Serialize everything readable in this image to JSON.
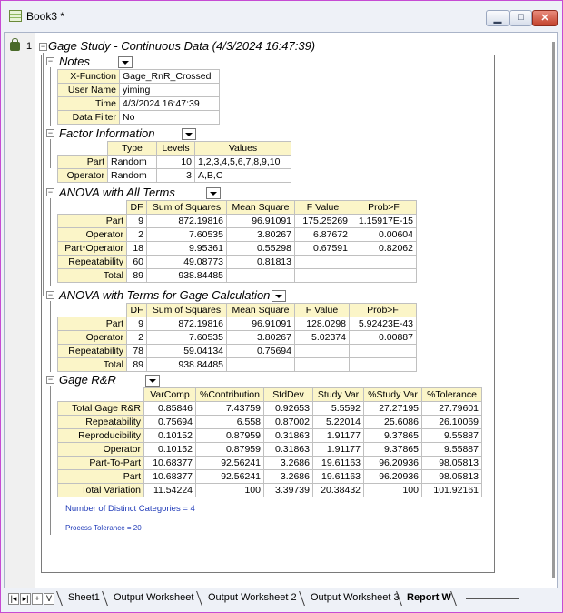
{
  "window": {
    "title": "Book3 *",
    "min_glyph": "▁",
    "max_glyph": "□",
    "close_glyph": "✕"
  },
  "row_number": "1",
  "report": {
    "title": "Gage Study - Continuous Data (4/3/2024 16:47:39)"
  },
  "notes": {
    "title": "Notes",
    "rows": [
      {
        "label": "X-Function",
        "value": "Gage_RnR_Crossed"
      },
      {
        "label": "User Name",
        "value": "yiming"
      },
      {
        "label": "Time",
        "value": "4/3/2024 16:47:39"
      },
      {
        "label": "Data Filter",
        "value": "No"
      }
    ]
  },
  "factor_info": {
    "title": "Factor Information",
    "headers": [
      "Type",
      "Levels",
      "Values"
    ],
    "rows": [
      {
        "label": "Part",
        "type": "Random",
        "levels": "10",
        "values": "1,2,3,4,5,6,7,8,9,10"
      },
      {
        "label": "Operator",
        "type": "Random",
        "levels": "3",
        "values": "A,B,C"
      }
    ]
  },
  "anova_all": {
    "title": "ANOVA with All Terms",
    "headers": [
      "DF",
      "Sum of Squares",
      "Mean Square",
      "F Value",
      "Prob>F"
    ],
    "rows": [
      {
        "label": "Part",
        "df": "9",
        "ss": "872.19816",
        "ms": "96.91091",
        "f": "175.25269",
        "p": "1.15917E-15"
      },
      {
        "label": "Operator",
        "df": "2",
        "ss": "7.60535",
        "ms": "3.80267",
        "f": "6.87672",
        "p": "0.00604"
      },
      {
        "label": "Part*Operator",
        "df": "18",
        "ss": "9.95361",
        "ms": "0.55298",
        "f": "0.67591",
        "p": "0.82062"
      },
      {
        "label": "Repeatability",
        "df": "60",
        "ss": "49.08773",
        "ms": "0.81813",
        "f": "",
        "p": ""
      },
      {
        "label": "Total",
        "df": "89",
        "ss": "938.84485",
        "ms": "",
        "f": "",
        "p": ""
      }
    ]
  },
  "anova_gage": {
    "title": "ANOVA with Terms for Gage Calculation",
    "headers": [
      "DF",
      "Sum of Squares",
      "Mean Square",
      "F Value",
      "Prob>F"
    ],
    "rows": [
      {
        "label": "Part",
        "df": "9",
        "ss": "872.19816",
        "ms": "96.91091",
        "f": "128.0298",
        "p": "5.92423E-43"
      },
      {
        "label": "Operator",
        "df": "2",
        "ss": "7.60535",
        "ms": "3.80267",
        "f": "5.02374",
        "p": "0.00887"
      },
      {
        "label": "Repeatability",
        "df": "78",
        "ss": "59.04134",
        "ms": "0.75694",
        "f": "",
        "p": ""
      },
      {
        "label": "Total",
        "df": "89",
        "ss": "938.84485",
        "ms": "",
        "f": "",
        "p": ""
      }
    ]
  },
  "gage_rr": {
    "title": "Gage R&R",
    "headers": [
      "VarComp",
      "%Contribution",
      "StdDev",
      "Study Var",
      "%Study Var",
      "%Tolerance"
    ],
    "rows": [
      {
        "label": "Total Gage R&R",
        "vals": [
          "0.85846",
          "7.43759",
          "0.92653",
          "5.5592",
          "27.27195",
          "27.79601"
        ]
      },
      {
        "label": "Repeatability",
        "vals": [
          "0.75694",
          "6.558",
          "0.87002",
          "5.22014",
          "25.6086",
          "26.10069"
        ]
      },
      {
        "label": "Reproducibility",
        "vals": [
          "0.10152",
          "0.87959",
          "0.31863",
          "1.91177",
          "9.37865",
          "9.55887"
        ]
      },
      {
        "label": "Operator",
        "vals": [
          "0.10152",
          "0.87959",
          "0.31863",
          "1.91177",
          "9.37865",
          "9.55887"
        ]
      },
      {
        "label": "Part-To-Part",
        "vals": [
          "10.68377",
          "92.56241",
          "3.2686",
          "19.61163",
          "96.20936",
          "98.05813"
        ]
      },
      {
        "label": "Part",
        "vals": [
          "10.68377",
          "92.56241",
          "3.2686",
          "19.61163",
          "96.20936",
          "98.05813"
        ]
      },
      {
        "label": "Total Variation",
        "vals": [
          "11.54224",
          "100",
          "3.39739",
          "20.38432",
          "100",
          "101.92161"
        ]
      }
    ],
    "distinct_categories": "Number of Distinct Categories = 4",
    "process_tolerance": "Process Tolerance = 20"
  },
  "tabs": {
    "nav": [
      "|◂",
      "▸|",
      "+",
      "V"
    ],
    "sheets": [
      {
        "label": "Sheet1",
        "active": false
      },
      {
        "label": "Output Worksheet",
        "active": false
      },
      {
        "label": "Output Worksheet 2",
        "active": false
      },
      {
        "label": "Output Worksheet 3",
        "active": false
      },
      {
        "label": "Report W",
        "active": true
      }
    ]
  }
}
